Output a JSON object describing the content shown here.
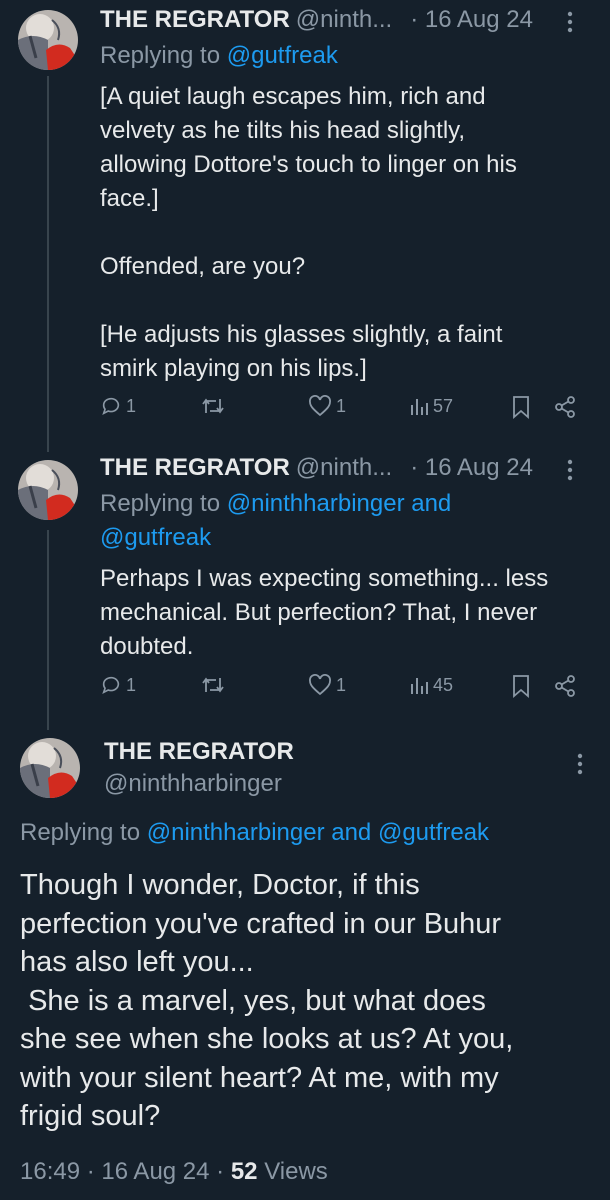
{
  "theme": {
    "background": "#15202b",
    "text": "#e7e9ea",
    "secondary": "#8b98a5",
    "link": "#1d9bf0"
  },
  "tweets": [
    {
      "display_name": "THE REGRATOR",
      "handle": "@ninth...",
      "date": "· 16 Aug 24",
      "replying_prefix": "Replying to ",
      "replying_to": "@gutfreak",
      "text": "[A quiet laugh escapes him, rich and\nvelvety as he tilts his head slightly,\nallowing Dottore's touch to linger on his\nface.]\n\nOffended, are you?\n\n[He adjusts his glasses slightly, a faint\nsmirk playing on his lips.]",
      "replies": "1",
      "retweets": "",
      "likes": "1",
      "views": "57",
      "icons": [
        "more-icon",
        "reply-icon",
        "retweet-icon",
        "like-icon",
        "views-icon",
        "bookmark-icon",
        "share-icon"
      ]
    },
    {
      "display_name": "THE REGRATOR",
      "handle": "@ninth...",
      "date": "· 16 Aug 24",
      "replying_prefix": "Replying to ",
      "replying_to": "@ninthharbinger and",
      "replying_to_2": "@gutfreak",
      "text": "Perhaps I was expecting something... less\nmechanical. But perfection? That, I never\ndoubted.",
      "replies": "1",
      "retweets": "",
      "likes": "1",
      "views": "45"
    }
  ],
  "main_tweet": {
    "display_name": "THE REGRATOR",
    "handle": "@ninthharbinger",
    "replying_prefix": "Replying to ",
    "replying_to_1": "@ninthharbinger",
    "replying_and": " and ",
    "replying_to_2": "@gutfreak",
    "text": "Though I wonder, Doctor, if this\nperfection you've crafted in our Buhur\nhas also left you...\n She is a marvel, yes, but what does\nshe see when she looks at us? At you,\nwith your silent heart? At me, with my\nfrigid soul?",
    "time": "16:49",
    "date": "16 Aug 24",
    "separator": " · ",
    "views_count": "52",
    "views_label": " Views"
  }
}
